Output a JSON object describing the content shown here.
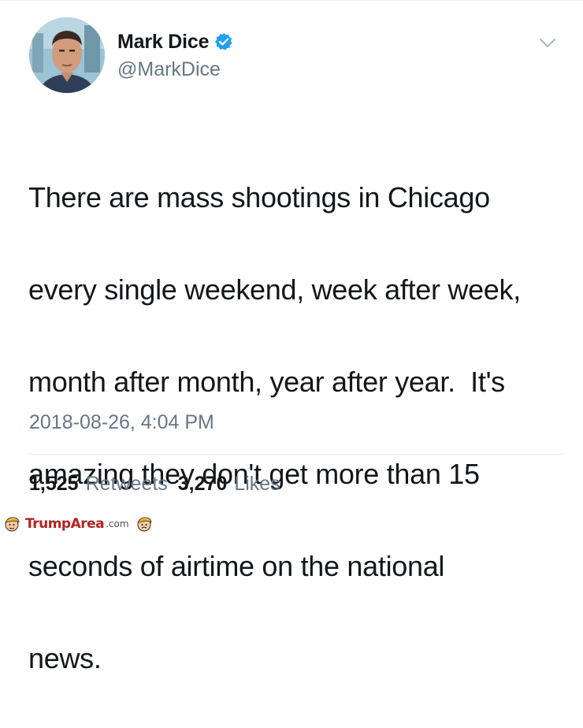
{
  "tweet": {
    "display_name": "Mark Dice",
    "handle": "@MarkDice",
    "verified": true,
    "text_lines": [
      "There are mass shootings in Chicago",
      "every single weekend, week after week,",
      "month after month, year after year.  It's",
      "amazing they don't get more than 15",
      "seconds of airtime on the national",
      "news."
    ],
    "timestamp": "2018-08-26, 4:04 PM",
    "retweets_count": "1,525",
    "retweets_label": "Retweets",
    "likes_count": "3,270",
    "likes_label": "Likes"
  },
  "watermark": {
    "brand": "TrumpArea",
    "suffix": ".com"
  },
  "colors": {
    "primary_text": "#14171a",
    "secondary_text": "#657786",
    "verified_blue": "#1da1f2",
    "divider": "#e6ecf0",
    "watermark_red": "#b22222"
  },
  "icons": {
    "verified": "verified-badge-icon",
    "caret": "chevron-down-icon"
  }
}
